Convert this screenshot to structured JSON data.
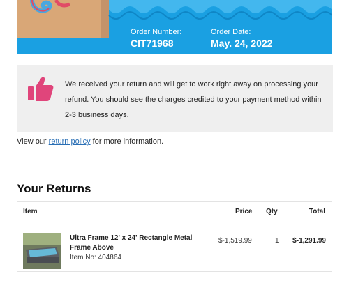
{
  "order": {
    "number_label": "Order Number:",
    "number": "CIT71968",
    "date_label": "Order Date:",
    "date": "May. 24, 2022"
  },
  "notice": {
    "icon": "thumbs-up-icon",
    "message": "We received your return and will get to work right away on processing your refund. You should see the charges credited to your payment method within 2-3 business days."
  },
  "policy": {
    "prefix": "View our",
    "link_text": "return policy",
    "suffix": "for more information."
  },
  "returns": {
    "title": "Your Returns",
    "columns": [
      "Item",
      "Price",
      "Qty",
      "Total"
    ],
    "items": [
      {
        "name": "Ultra Frame 12' x 24' Rectangle Metal Frame Above",
        "sku": "Item No: 404864",
        "price": "$-1,519.99",
        "qty": "1",
        "total": "$-1,291.99"
      }
    ]
  },
  "colors": {
    "hero_blue": "#1aa0e2",
    "notice_bg": "#efefef",
    "thumb_pink": "#e0457b",
    "link_blue": "#2a6fb5"
  }
}
